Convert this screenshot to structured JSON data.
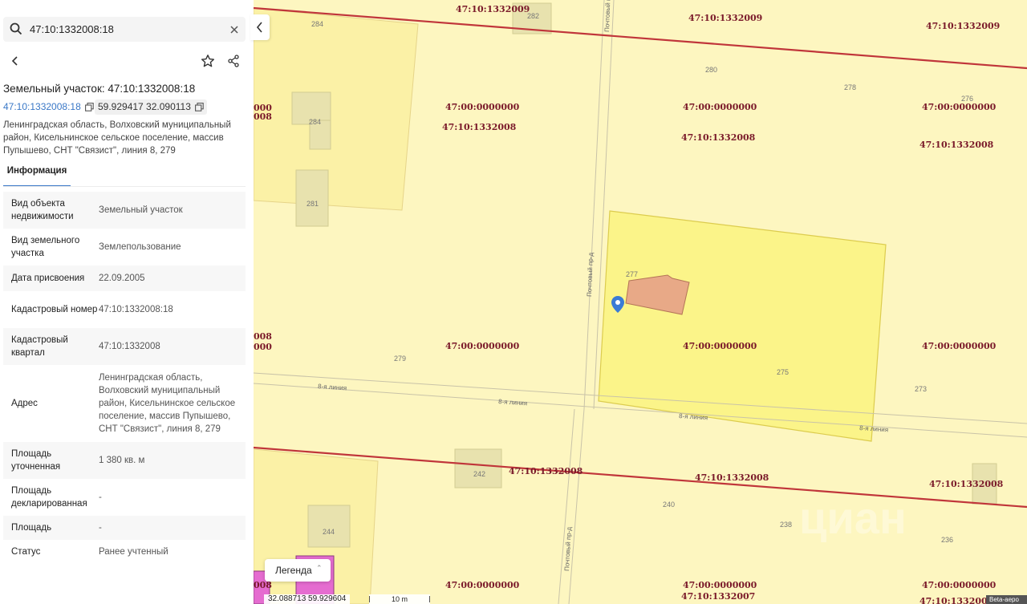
{
  "search": {
    "value": "47:10:1332008:18"
  },
  "panel": {
    "title": "Земельный участок: 47:10:1332008:18",
    "cad_link": "47:10:1332008:18",
    "coords": "59.929417 32.090113",
    "address": "Ленинградская область, Волховский муниципальный район, Кисельнинское сельское поселение, массив Пупышево, СНТ \"Связист\", линия 8, 279",
    "tab": "Информация",
    "props": [
      {
        "k": "Вид объекта недвижимости",
        "v": "Земельный участок"
      },
      {
        "k": "Вид земельного участка",
        "v": "Землепользование"
      },
      {
        "k": "Дата присвоения",
        "v": "22.09.2005"
      },
      {
        "k": "Кадастровый номер",
        "v": "47:10:1332008:18"
      },
      {
        "k": "Кадастровый квартал",
        "v": "47:10:1332008"
      },
      {
        "k": "Адрес",
        "v": "Ленинградская область, Волховский муниципальный район, Кисельнинское сельское поселение, массив Пупышево, СНТ \"Связист\", линия 8, 279"
      },
      {
        "k": "Площадь уточненная",
        "v": "1 380 кв. м"
      },
      {
        "k": "Площадь декларированная",
        "v": "-"
      },
      {
        "k": "Площадь",
        "v": "-"
      },
      {
        "k": "Статус",
        "v": "Ранее учтенный"
      }
    ]
  },
  "map": {
    "quarter_labels": [
      "47:10:1332009",
      "47:10:1332009",
      "47:10:1332009",
      "47:00:0000000",
      "47:00:0000000",
      "47:00:0000000",
      "47:10:1332008",
      "47:10:1332008",
      "47:10:1332008",
      "47:00:0000000",
      "47:00:0000000",
      "47:00:0000000",
      "47:10:1332008",
      "47:10:1332008",
      "47:10:1332008",
      "47:00:0000000",
      "47:00:0000000",
      "47:00:0000000",
      "47:10:1332007",
      "47:10:1332009",
      "000",
      "008",
      "008",
      "000",
      "008"
    ],
    "parcel_numbers": [
      "284",
      "282",
      "280",
      "278",
      "276",
      "284",
      "281",
      "277",
      "279",
      "275",
      "273",
      "242",
      "240",
      "238",
      "236",
      "244"
    ],
    "street_names": [
      "Почтовый пр-д",
      "Почтовый пр-д",
      "Почтовый пр-д",
      "8-я линия",
      "8-я линия",
      "8-я линия",
      "8-я линия"
    ],
    "colors": {
      "base": "#fdf6c0",
      "selected": "#fbf489",
      "boundary": "#c0353a",
      "building": "#e8a987",
      "pin": "#3a7bd5",
      "commercial": "#e56cd0"
    },
    "legend_label": "Легенда",
    "cursor_coords": "32.088713  59.929604",
    "scale_label": "10 m",
    "beta_label": "Beta-aepo",
    "watermark": "циан"
  }
}
